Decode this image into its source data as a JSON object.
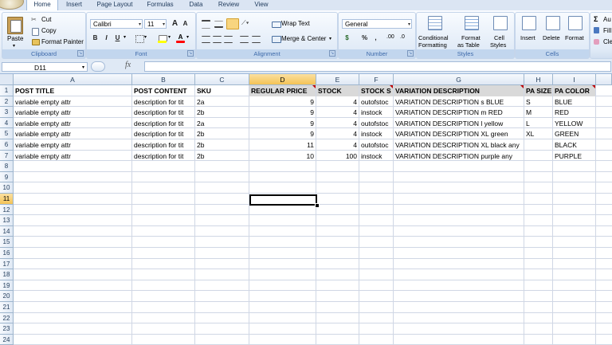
{
  "tabs": [
    "Home",
    "Insert",
    "Page Layout",
    "Formulas",
    "Data",
    "Review",
    "View"
  ],
  "clipboard": {
    "paste": "Paste",
    "cut": "Cut",
    "copy": "Copy",
    "format_painter": "Format Painter",
    "label": "Clipboard"
  },
  "font": {
    "name": "Calibri",
    "size": "11",
    "grow": "A",
    "shrink": "A",
    "bold": "B",
    "italic": "I",
    "underline": "U",
    "label": "Font"
  },
  "alignment": {
    "wrap": "Wrap Text",
    "merge": "Merge & Center",
    "label": "Alignment"
  },
  "number": {
    "format": "General",
    "currency": "$",
    "percent": "%",
    "comma": ",",
    "label": "Number"
  },
  "styles": {
    "conditional": "Conditional",
    "formatting": "Formatting",
    "format_as": "Format",
    "as_table": "as Table",
    "cell": "Cell",
    "cell_styles": "Styles",
    "label": "Styles"
  },
  "cells": {
    "insert": "Insert",
    "delete": "Delete",
    "format": "Format",
    "label": "Cells"
  },
  "editing": {
    "sigma": "Σ",
    "autosum": "Au",
    "fill": "Fill",
    "clear": "Cle"
  },
  "formula_bar": {
    "name_box": "D11",
    "fx": "fx",
    "value": ""
  },
  "columns": [
    "A",
    "B",
    "C",
    "D",
    "E",
    "F",
    "G",
    "H",
    "I"
  ],
  "rows": [
    "1",
    "2",
    "3",
    "4",
    "5",
    "6",
    "7",
    "8",
    "9",
    "10",
    "11",
    "12",
    "13",
    "14",
    "15",
    "16",
    "17",
    "18",
    "19",
    "20",
    "21",
    "22",
    "23",
    "24"
  ],
  "headers": [
    "POST TITLE",
    "POST CONTENT",
    "SKU",
    "REGULAR PRICE",
    "STOCK",
    "STOCK S",
    "VARIATION DESCRIPTION",
    "PA SIZE",
    "PA COLOR"
  ],
  "data": [
    [
      "variable empty attr",
      "description for tit",
      "2a",
      "9",
      "4",
      "outofstoc",
      "VARIATION DESCRIPTION s BLUE",
      "S",
      "BLUE"
    ],
    [
      "variable empty attr",
      "description for tit",
      "2b",
      "9",
      "4",
      "instock",
      "VARIATION DESCRIPTION m RED",
      "M",
      "RED"
    ],
    [
      "variable empty attr",
      "description for tit",
      "2a",
      "9",
      "4",
      "outofstoc",
      "VARIATION DESCRIPTION l yellow",
      "L",
      "YELLOW"
    ],
    [
      "variable empty attr",
      "description for tit",
      "2b",
      "9",
      "4",
      "instock",
      "VARIATION DESCRIPTION XL green",
      "XL",
      "GREEN"
    ],
    [
      "variable empty attr",
      "description for tit",
      "2b",
      "11",
      "4",
      "outofstoc",
      "VARIATION DESCRIPTION XL black any",
      "",
      "BLACK"
    ],
    [
      "variable empty attr",
      "description for tit",
      "2b",
      "10",
      "100",
      "instock",
      "VARIATION DESCRIPTION purple any",
      "",
      "PURPLE"
    ]
  ]
}
